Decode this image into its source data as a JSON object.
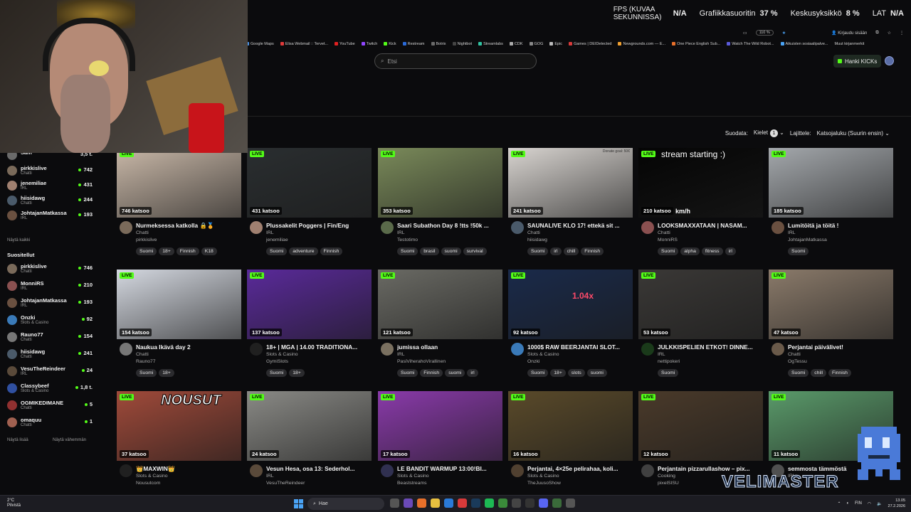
{
  "hud": {
    "fps_label": "FPS (KUVAA SEKUNNISSA)",
    "fps_value": "N/A",
    "gpu_label": "Grafiikkasuoritin",
    "gpu_value": "37 %",
    "cpu_label": "Keskusyksikkö",
    "cpu_value": "8 %",
    "lat_label": "LAT",
    "lat_value": "N/A"
  },
  "browser": {
    "zoom": "110 %",
    "login": "Kirjaudu sisään",
    "bookmarks": [
      "Google Maps",
      "Elisa Webmail :: Tervet...",
      "YouTube",
      "Twitch",
      "Kick",
      "Restream",
      "Botrix",
      "Nightbot",
      "Streamlabs",
      "CDK",
      "GOG",
      "Epic",
      "Games | DEIDetected",
      "Newgrounds.com — E...",
      "One Piece English Sub...",
      "Watch The Wild Robot...",
      "Aikuisten sosiaalipalve..."
    ],
    "other_bookmarks": "Muut kirjanmerkit"
  },
  "header": {
    "search_placeholder": "Etsi",
    "get_kicks": "Hanki KICKs"
  },
  "filters": {
    "filter_label": "Suodata:",
    "languages_label": "Kielet",
    "languages_count": "1",
    "sort_label": "Lajittele:",
    "sort_value": "Katsojaluku (Suurin ensin)"
  },
  "sidebar": {
    "top_partial": {
      "name": "Sam",
      "count": "3,5 t."
    },
    "recommended": [
      {
        "name": "pirkkislive",
        "category": "Chatti",
        "count": "742",
        "color": "#7a6a5a"
      },
      {
        "name": "jenemiliae",
        "category": "IRL",
        "count": "431",
        "color": "#a08070"
      },
      {
        "name": "hiisidawg",
        "category": "Chatti",
        "count": "244",
        "color": "#4a5a6a"
      },
      {
        "name": "JohtajanMatkassa",
        "category": "IRL",
        "count": "193",
        "color": "#6a5040"
      }
    ],
    "show_all": "Näytä kaikki",
    "followed_heading": "Suositellut",
    "followed": [
      {
        "name": "pirkkislive",
        "category": "Chatti",
        "count": "746",
        "color": "#7a6a5a"
      },
      {
        "name": "MonniRS",
        "category": "IRL",
        "count": "210",
        "color": "#8a5050"
      },
      {
        "name": "JohtajanMatkassa",
        "category": "IRL",
        "count": "193",
        "color": "#6a5040"
      },
      {
        "name": "Onzki",
        "category": "Slots & Casino",
        "count": "92",
        "color": "#3a7ab8"
      },
      {
        "name": "Rauno77",
        "category": "Chatti",
        "count": "154",
        "color": "#777777"
      },
      {
        "name": "hiisidawg",
        "category": "Chatti",
        "count": "241",
        "color": "#4a5a6a"
      },
      {
        "name": "VesuTheReindeer",
        "category": "IRL",
        "count": "24",
        "color": "#5a4a3a"
      },
      {
        "name": "Classybeef",
        "category": "Slots & Casino",
        "count": "1,8 t.",
        "color": "#3050a0"
      },
      {
        "name": "OGMIKEDIMANE",
        "category": "Chatti",
        "count": "5",
        "color": "#903030"
      },
      {
        "name": "omaquu",
        "category": "Chatti",
        "count": "1",
        "color": "#a06050"
      }
    ],
    "show_more": "Näytä lisää",
    "show_less": "Näytä vähemmän"
  },
  "streams": [
    {
      "viewers": "746 katsoo",
      "title": "Nurmeksessa katkolla 🔒🏅",
      "category": "Chatti",
      "channel": "pirkkislive",
      "tags": [
        "Suomi",
        "18+",
        "Finnish",
        "K18"
      ],
      "thumb_color": "#c9b8a8",
      "avatar_color": "#7a6a5a"
    },
    {
      "viewers": "431 katsoo",
      "title": "Plussakelit Poggers | Fin/Eng",
      "category": "IRL",
      "channel": "jenemiliae",
      "tags": [
        "Suomi",
        "adventure",
        "Finnish"
      ],
      "thumb_color": "#2a2e30",
      "avatar_color": "#a08070"
    },
    {
      "viewers": "353 katsoo",
      "title": "Saari Subathon Day 8 !tts !50k ...",
      "category": "IRL",
      "channel": "Testotimo",
      "tags": [
        "Suomi",
        "brasil",
        "suomi",
        "survival"
      ],
      "thumb_color": "#7a8a5a",
      "avatar_color": "#5a6a4a"
    },
    {
      "viewers": "241 katsoo",
      "title": "SAUNALIVE KLO 17! ettekä sit ...",
      "category": "Chatti",
      "channel": "hiisidawg",
      "tags": [
        "Suomi",
        "irl",
        "chill",
        "Finnish"
      ],
      "thumb_color": "#d8d4d0",
      "avatar_color": "#4a5a6a"
    },
    {
      "viewers": "210 katsoo",
      "title": "LOOKSMAXXATAAN | NASAM...",
      "category": "Chatti",
      "channel": "MonniRS",
      "tags": [
        "Suomi",
        "alpha",
        "fitness",
        "irl"
      ],
      "thumb_color": "#050505",
      "avatar_color": "#8a5050"
    },
    {
      "viewers": "185 katsoo",
      "title": "Lumitöitä ja töitä !",
      "category": "IRL",
      "channel": "JohtajanMatkassa",
      "tags": [
        "Suomi"
      ],
      "thumb_color": "#a4a8ac",
      "avatar_color": "#6a5040"
    },
    {
      "viewers": "154 katsoo",
      "title": "Naukua Ikävä day 2",
      "category": "Chatti",
      "channel": "Rauno77",
      "tags": [
        "Suomi",
        "18+"
      ],
      "thumb_color": "#d4d8e0",
      "avatar_color": "#777777"
    },
    {
      "viewers": "137 katsoo",
      "title": "18+ | MGA | 14.00 TRADITIONA...",
      "category": "Slots & Casino",
      "channel": "GymiSlots",
      "tags": [
        "Suomi",
        "18+"
      ],
      "thumb_color": "#5a2a9a",
      "avatar_color": "#202020"
    },
    {
      "viewers": "121 katsoo",
      "title": "jumissa ollaan",
      "category": "IRL",
      "channel": "PasiViherahoVirallinen",
      "tags": [
        "Suomi",
        "Finnish",
        "suomi",
        "irl"
      ],
      "thumb_color": "#6a6a64",
      "avatar_color": "#7a7060"
    },
    {
      "viewers": "92 katsoo",
      "title": "1000$ RAW BEERJANTAI SLOT...",
      "category": "Slots & Casino",
      "channel": "Onzki",
      "tags": [
        "Suomi",
        "18+",
        "slots",
        "suomi"
      ],
      "thumb_color": "#1a2a4a",
      "avatar_color": "#3a7ab8"
    },
    {
      "viewers": "53 katsoo",
      "title": "JULKKISPELIEN ETKOT! DINNE...",
      "category": "IRL",
      "channel": "nettipokeri",
      "tags": [
        "Suomi"
      ],
      "thumb_color": "#3a3836",
      "avatar_color": "#1a3a1a"
    },
    {
      "viewers": "47 katsoo",
      "title": "Perjantai päivälivet!",
      "category": "Chatti",
      "channel": "OgTessu",
      "tags": [
        "Suomi",
        "chill",
        "Finnish"
      ],
      "thumb_color": "#8a7a6a",
      "avatar_color": "#6a5a4a"
    },
    {
      "viewers": "37 katsoo",
      "title": "👑MAXWIN👑",
      "category": "Slots & Casino",
      "channel": "Nousutcom",
      "tags": [],
      "thumb_color": "#a04a3a",
      "avatar_color": "#202020"
    },
    {
      "viewers": "24 katsoo",
      "title": "Vesun Hesa, osa 13: Sederhol...",
      "category": "IRL",
      "channel": "VesuTheReindeer",
      "tags": [],
      "thumb_color": "#8a8a86",
      "avatar_color": "#5a4a3a"
    },
    {
      "viewers": "17 katsoo",
      "title": "LE BANDIT WARMUP 13:00!BI...",
      "category": "Slots & Casino",
      "channel": "Beaststreams",
      "tags": [],
      "thumb_color": "#8a3aaa",
      "avatar_color": "#303050"
    },
    {
      "viewers": "16 katsoo",
      "title": "Perjantai, 4×25e pelirahaa, koli...",
      "category": "Slots & Casino",
      "channel": "TheJuusoShow",
      "tags": [],
      "thumb_color": "#5a4a2a",
      "avatar_color": "#504030"
    },
    {
      "viewers": "12 katsoo",
      "title": "Perjantain pizzarullashow – pix...",
      "category": "Cooking",
      "channel": "pixelSISU",
      "tags": [],
      "thumb_color": "#4a3a2a",
      "avatar_color": "#404040"
    },
    {
      "viewers": "11 katsoo",
      "title": "semmosta tämmöstä",
      "category": "IRL",
      "channel": "",
      "tags": [],
      "thumb_color": "#5a9a6a",
      "avatar_color": "#505050"
    }
  ],
  "thumb_overlays": {
    "stream_starting": "stream starting :)",
    "kmh": "km/h",
    "multiplier": "1.04x",
    "nousut": "NOUSUT",
    "donate_goal": "Donate goal: 50€"
  },
  "brand": {
    "name": "VELIMASTER"
  },
  "taskbar": {
    "temp": "2°C",
    "weather": "Pilvistä",
    "search": "Hae",
    "lang": "FIN",
    "time": "13.05",
    "date": "27.2.2026"
  }
}
